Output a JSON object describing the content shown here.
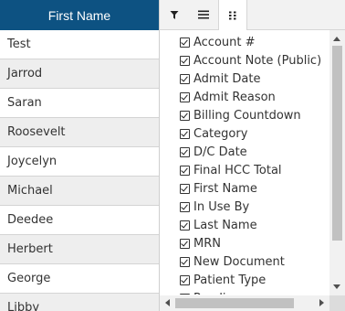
{
  "grid": {
    "header": "First Name",
    "rows": [
      "Test",
      "Jarrod",
      "Saran",
      "Roosevelt",
      "Joycelyn",
      "Michael",
      "Deedee",
      "Herbert",
      "George",
      "Libby"
    ]
  },
  "column_menu": {
    "tabs": [
      {
        "name": "filter-icon",
        "active": false
      },
      {
        "name": "general-menu-icon",
        "active": false
      },
      {
        "name": "columns-icon",
        "active": true
      }
    ],
    "columns": [
      {
        "label": "Account #",
        "checked": true
      },
      {
        "label": "Account Note (Public)",
        "checked": true
      },
      {
        "label": "Admit Date",
        "checked": true
      },
      {
        "label": "Admit Reason",
        "checked": true
      },
      {
        "label": "Billing Countdown",
        "checked": true
      },
      {
        "label": "Category",
        "checked": true
      },
      {
        "label": "D/C Date",
        "checked": true
      },
      {
        "label": "Final HCC Total",
        "checked": true
      },
      {
        "label": "First Name",
        "checked": true
      },
      {
        "label": "In Use By",
        "checked": true
      },
      {
        "label": "Last Name",
        "checked": true
      },
      {
        "label": "MRN",
        "checked": true
      },
      {
        "label": "New Document",
        "checked": true
      },
      {
        "label": "Patient Type",
        "checked": true
      },
      {
        "label": "Pending",
        "checked": true
      }
    ]
  },
  "colors": {
    "header_bg": "#0d5282",
    "row_alt_bg": "#eeeeee",
    "menu_tab_bg": "#f2f2f2"
  }
}
